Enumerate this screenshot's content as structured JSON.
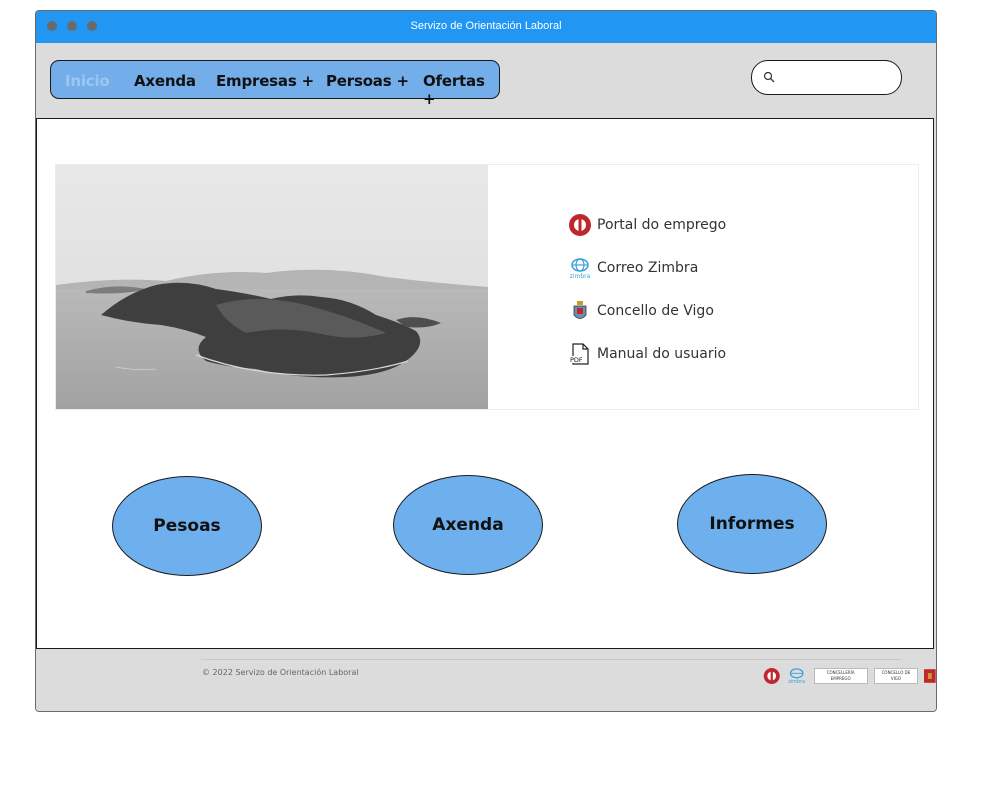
{
  "window": {
    "title": "Servizo de Orientación Laboral"
  },
  "nav": {
    "items": [
      {
        "label": "Inicio",
        "active": true
      },
      {
        "label": "Axenda"
      },
      {
        "label": "Empresas +"
      },
      {
        "label": "Persoas +"
      },
      {
        "label": "Ofertas +"
      }
    ]
  },
  "search": {
    "value": "",
    "placeholder": "",
    "icon": "search-icon"
  },
  "hero": {
    "image": "black-and-white-aerial-island-photo",
    "links": [
      {
        "label": "Portal do emprego",
        "icon": "portal-emprego-logo-icon"
      },
      {
        "label": "Correo Zimbra",
        "icon": "zimbra-logo-icon",
        "icon_text": "zimbra"
      },
      {
        "label": "Concello de Vigo",
        "icon": "vigo-coat-of-arms-icon"
      },
      {
        "label": "Manual do usuario",
        "icon": "pdf-file-icon",
        "icon_text": "PDF"
      }
    ]
  },
  "actions": [
    {
      "label": "Pesoas"
    },
    {
      "label": "Axenda"
    },
    {
      "label": "Informes"
    }
  ],
  "footer": {
    "copyright": "© 2022 Servizo de Orientación Laboral",
    "badges": {
      "zimbra": "zimbra",
      "concelleria": "CONCELLERÍA EMPREGO",
      "concello": "CONCELLO DE VIGO"
    }
  },
  "colors": {
    "titlebar": "#2196f3",
    "nav_bg": "#73adea",
    "button_bg": "#6eb0ee",
    "chrome_bg": "#dcdcdc"
  }
}
